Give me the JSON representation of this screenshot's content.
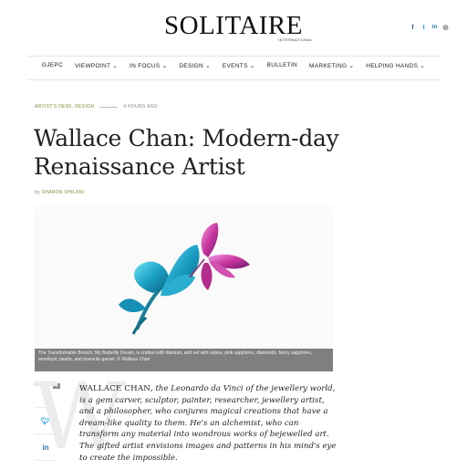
{
  "header": {
    "logo": "SOLITAIRE",
    "logo_sub": "INTERNATIONAL",
    "social": [
      {
        "icon": "facebook-icon",
        "glyph": "f"
      },
      {
        "icon": "twitter-icon",
        "glyph": "t"
      },
      {
        "icon": "linkedin-icon",
        "glyph": "in"
      },
      {
        "icon": "instagram-icon",
        "glyph": "◎"
      }
    ]
  },
  "nav": [
    {
      "label": "GJEPC",
      "dropdown": false
    },
    {
      "label": "VIEWPOINT",
      "dropdown": true
    },
    {
      "label": "IN FOCUS",
      "dropdown": true
    },
    {
      "label": "DESIGN",
      "dropdown": true
    },
    {
      "label": "EVENTS",
      "dropdown": true
    },
    {
      "label": "BULLETIN",
      "dropdown": false
    },
    {
      "label": "MARKETING",
      "dropdown": true
    },
    {
      "label": "HELPING HANDS",
      "dropdown": true
    }
  ],
  "article": {
    "categories": "ARTIST'S DESK, DESIGN",
    "time": "4 HOURS AGO",
    "title": "Wallace Chan: Modern-day Renaissance Artist",
    "by_prefix": "by",
    "author": "SHARON DHILANI",
    "caption": "The Transformable Brooch, My Butterfly Dream, is crafted with titanium, and set with rubies, pink sapphires, diamonds, fancy sapphires, amethyst, pearls, and tsavorite garnet. © Wallace Chan",
    "dropcap": "W",
    "body_lead": "WALLACE CHAN",
    "body_text": ", the Leonardo da Vinci of the jewellery world, is a gem carver, sculptor, painter, researcher, jewellery artist, and a philosopher, who conjures magical creations that have a dream-like quality to them. He's an alchemist, who can transform any material into wondrous works of bejewelled art. The gifted artist envisions images and patterns in his mind's eye to create the impossible.",
    "share_count": "0"
  },
  "colors": {
    "accent_olive": "#8a8a3a",
    "share_blue": "#2b72b7",
    "caption_bg": "#7f7f7f"
  }
}
